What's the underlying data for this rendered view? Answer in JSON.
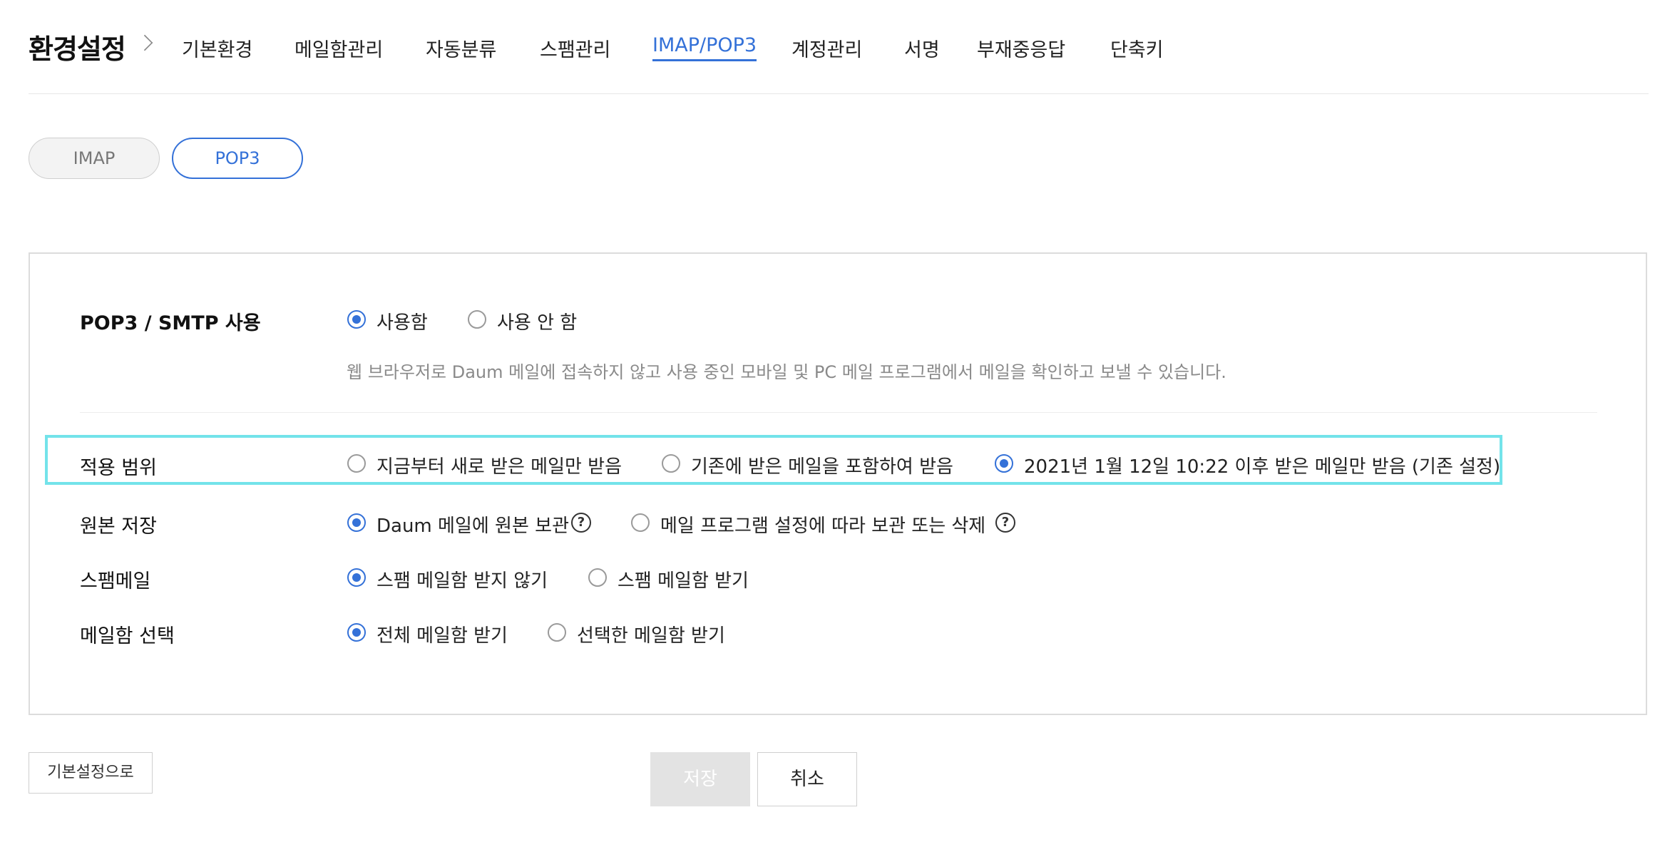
{
  "header": {
    "title": "환경설정",
    "tabs": [
      {
        "label": "기본환경"
      },
      {
        "label": "메일함관리"
      },
      {
        "label": "자동분류"
      },
      {
        "label": "스팸관리"
      },
      {
        "label": "IMAP/POP3"
      },
      {
        "label": "계정관리"
      },
      {
        "label": "서명"
      },
      {
        "label": "부재중응답"
      },
      {
        "label": "단축키"
      }
    ],
    "active_tab": "IMAP/POP3"
  },
  "subtabs": {
    "imap": "IMAP",
    "pop3": "POP3",
    "active": "POP3"
  },
  "settings": {
    "pop3_smtp": {
      "label": "POP3 / SMTP 사용",
      "options": [
        "사용함",
        "사용 안 함"
      ],
      "selected": "사용함",
      "description": "웹 브라우저로 Daum 메일에 접속하지 않고 사용 중인 모바일 및 PC 메일 프로그램에서 메일을 확인하고 보낼 수 있습니다."
    },
    "scope": {
      "label": "적용 범위",
      "options": [
        "지금부터 새로 받은 메일만 받음",
        "기존에 받은 메일을 포함하여 받음",
        "2021년 1월 12일 10:22 이후 받은 메일만 받음 (기존 설정)"
      ],
      "selected": "2021년 1월 12일 10:22 이후 받은 메일만 받음 (기존 설정)"
    },
    "original": {
      "label": "원본 저장",
      "options": [
        "Daum 메일에 원본 보관",
        "메일 프로그램 설정에 따라 보관 또는 삭제"
      ],
      "selected": "Daum 메일에 원본 보관",
      "help": "?"
    },
    "spam": {
      "label": "스팸메일",
      "options": [
        "스팸 메일함 받지 않기",
        "스팸 메일함 받기"
      ],
      "selected": "스팸 메일함 받지 않기"
    },
    "mailbox": {
      "label": "메일함 선택",
      "options": [
        "전체 메일함 받기",
        "선택한 메일함 받기"
      ],
      "selected": "전체 메일함 받기"
    }
  },
  "buttons": {
    "reset": "기본설정으로",
    "save": "저장",
    "cancel": "취소"
  },
  "colors": {
    "accent": "#3471d8",
    "highlight": "#73e3ea"
  }
}
